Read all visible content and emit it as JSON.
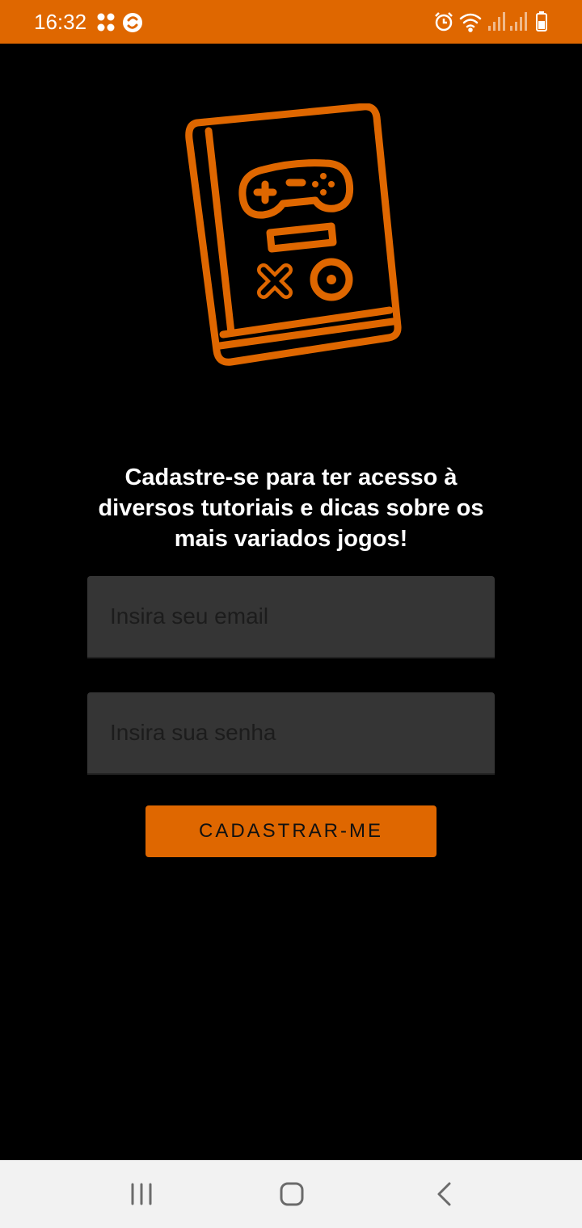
{
  "status_bar": {
    "time": "16:32",
    "background": "#DF6700",
    "left_icons": [
      "notification-grid-icon",
      "sync-app-icon"
    ],
    "right_icons": [
      "alarm-icon",
      "wifi-icon",
      "signal-icon",
      "signal-icon",
      "battery-icon"
    ]
  },
  "logo": {
    "icon": "game-book-icon",
    "color": "#DF6700"
  },
  "headline": "Cadastre-se para ter acesso à diversos tutoriais e dicas sobre os mais variados jogos!",
  "form": {
    "email": {
      "value": "",
      "placeholder": "Insira seu email"
    },
    "password": {
      "value": "",
      "placeholder": "Insira sua senha"
    },
    "submit_label": "CADASTRAR-ME"
  },
  "nav_bar": {
    "buttons": [
      "recents-icon",
      "home-icon",
      "back-icon"
    ]
  },
  "colors": {
    "accent": "#DF6700",
    "background": "#000000",
    "field_background": "#353535",
    "nav_background": "#F2F2F2"
  }
}
